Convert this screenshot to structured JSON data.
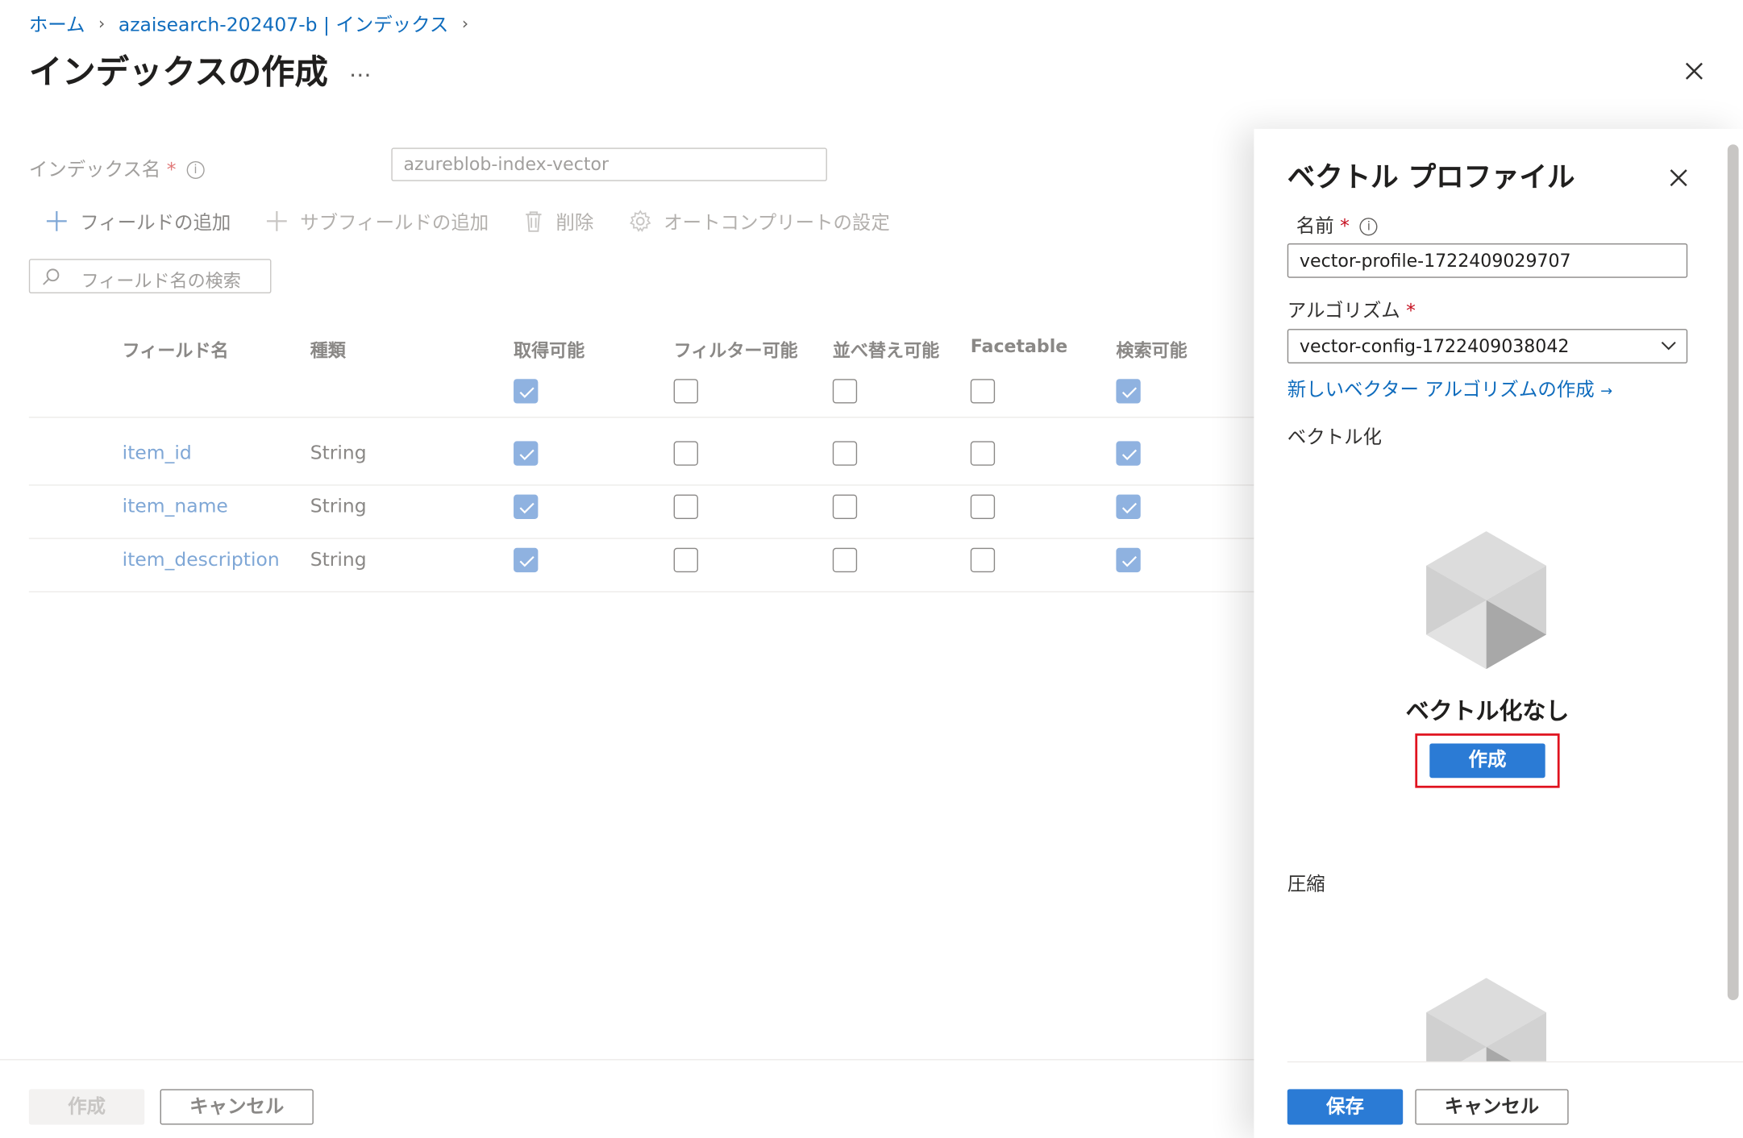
{
  "breadcrumb": [
    "ホーム",
    "azaisearch-202407-b | インデックス"
  ],
  "page_title": "インデックスの作成",
  "more_label": "…",
  "index_name": {
    "label": "インデックス名",
    "required": "*",
    "value": "azureblob-index-vector"
  },
  "toolbar": {
    "add_field": "フィールドの追加",
    "add_subfield": "サブフィールドの追加",
    "delete": "削除",
    "autocomplete": "オートコンプリートの設定"
  },
  "search": {
    "placeholder": "フィールド名の検索"
  },
  "table": {
    "headers": [
      "フィールド名",
      "種類",
      "取得可能",
      "フィルター可能",
      "並べ替え可能",
      "Facetable",
      "検索可能"
    ],
    "header_checks": [
      true,
      false,
      false,
      false,
      true
    ],
    "rows": [
      {
        "name": "item_id",
        "type": "String",
        "checks": [
          true,
          false,
          false,
          false,
          true
        ]
      },
      {
        "name": "item_name",
        "type": "String",
        "checks": [
          true,
          false,
          false,
          false,
          true
        ]
      },
      {
        "name": "item_description",
        "type": "String",
        "checks": [
          true,
          false,
          false,
          false,
          true
        ]
      }
    ]
  },
  "footer": {
    "create": "作成",
    "cancel": "キャンセル"
  },
  "panel": {
    "title": "ベクトル プロファイル",
    "name_label": "名前",
    "required": "*",
    "name_value": "vector-profile-1722409029707",
    "algorithm_label": "アルゴリズム",
    "algorithm_value": "vector-config-1722409038042",
    "new_algorithm_link": "新しいベクター アルゴリズムの作成",
    "vectorization_label": "ベクトル化",
    "empty_title": "ベクトル化なし",
    "create_button": "作成",
    "compression_label": "圧縮",
    "save": "保存",
    "cancel": "キャンセル"
  },
  "colors": {
    "accent": "#2b7bd5",
    "link": "#0f6cbd",
    "highlight": "#e0131f"
  }
}
